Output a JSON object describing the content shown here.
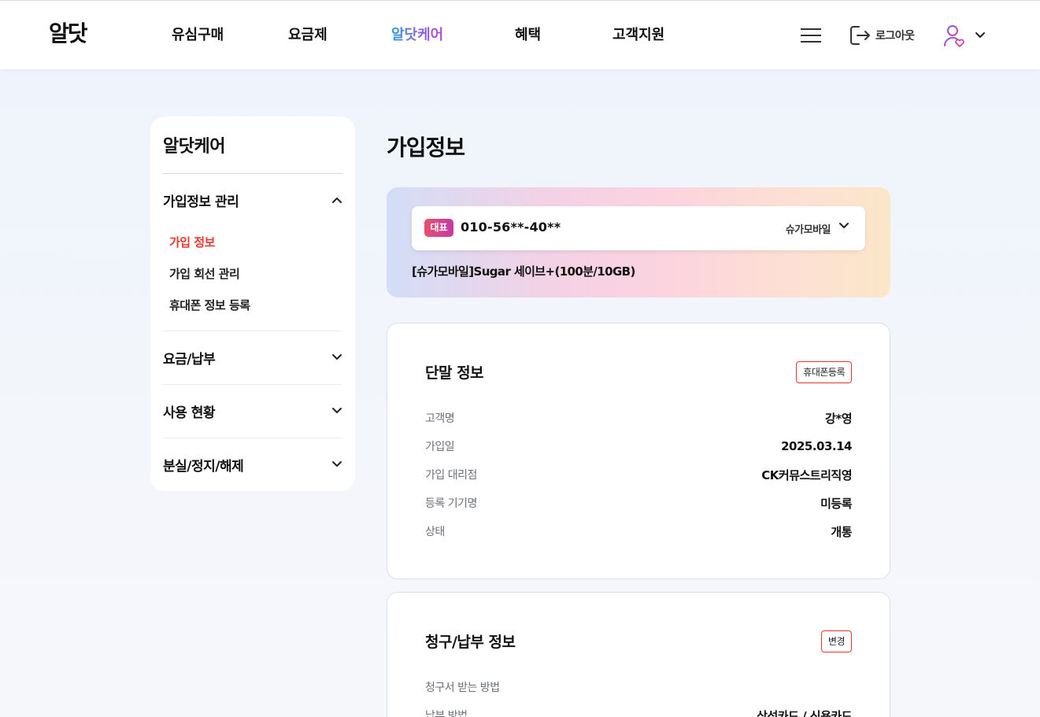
{
  "header": {
    "logo": "알닷",
    "nav": [
      "유심구매",
      "요금제",
      "알닷케어",
      "혜택",
      "고객지원"
    ],
    "active_nav": "알닷케어",
    "logout_label": "로그아웃"
  },
  "sidebar": {
    "title": "알닷케어",
    "sections": [
      {
        "label": "가입정보 관리",
        "expanded": true,
        "items": [
          "가입 정보",
          "가입 회선 관리",
          "휴대폰 정보 등록"
        ],
        "active_item": "가입 정보"
      },
      {
        "label": "요금/납부",
        "expanded": false
      },
      {
        "label": "사용 현황",
        "expanded": false
      },
      {
        "label": "분실/정지/해제",
        "expanded": false
      }
    ]
  },
  "main": {
    "page_title": "가입정보",
    "subscription": {
      "badge": "대표",
      "phone_number": "010-56**-40**",
      "carrier": "슈가모바일",
      "plan": "[슈가모바일]Sugar 세이브+(100분/10GB)"
    },
    "device_info": {
      "title": "단말 정보",
      "button": "휴대폰등록",
      "rows": [
        {
          "label": "고객명",
          "value": "강*영"
        },
        {
          "label": "가입일",
          "value": "2025.03.14"
        },
        {
          "label": "가입 대리점",
          "value": "CK커뮤스트리직영"
        },
        {
          "label": "등록 기기명",
          "value": "미등록"
        },
        {
          "label": "상태",
          "value": "개통"
        }
      ]
    },
    "billing_info": {
      "title": "청구/납부 정보",
      "button": "변경",
      "rows": [
        {
          "label": "청구서 받는 방법",
          "value": ""
        },
        {
          "label": "납부 방법",
          "value": "삼성카드 / 신용카드"
        }
      ]
    }
  },
  "colors": {
    "accent_red": "#e8392f",
    "nav_active_gradient_start": "#2e9fd6",
    "nav_active_gradient_end": "#b14fd8"
  }
}
